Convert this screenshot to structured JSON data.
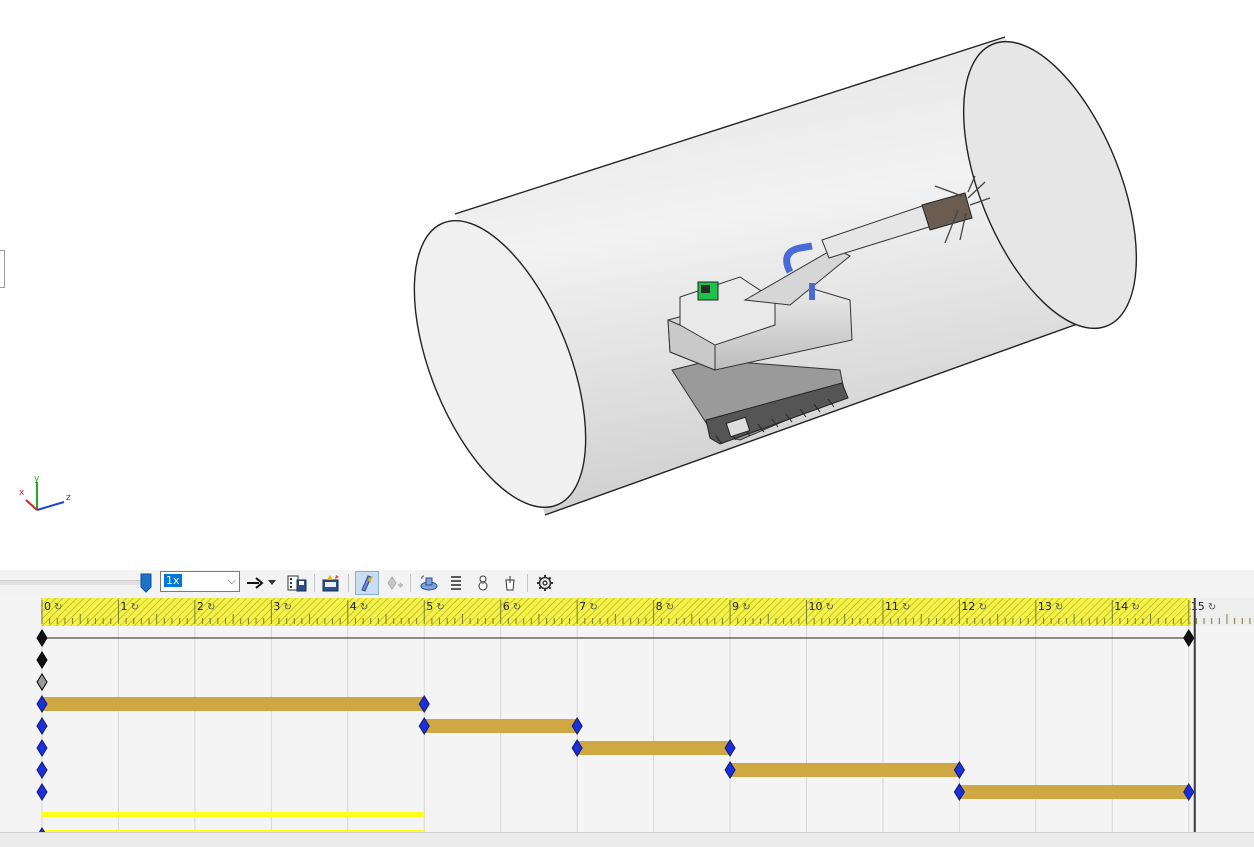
{
  "toolbar": {
    "speed": "1x",
    "buttons": [
      {
        "icon": "play-arrow-icon"
      },
      {
        "icon": "dropdown-arrow-icon"
      },
      {
        "icon": "save-animation-icon"
      },
      {
        "icon": "animation-wizard-icon"
      },
      {
        "icon": "autokey-icon",
        "active": true
      },
      {
        "icon": "add-key-icon",
        "disabled": true
      },
      {
        "icon": "motor-icon"
      },
      {
        "icon": "spring-icon"
      },
      {
        "icon": "contact-icon"
      },
      {
        "icon": "gravity-icon"
      },
      {
        "icon": "properties-gear-icon"
      }
    ]
  },
  "timeline": {
    "seconds": [
      "0",
      "1",
      "2",
      "3",
      "4",
      "5",
      "6",
      "7",
      "8",
      "9",
      "10",
      "11",
      "12",
      "13",
      "14",
      "15"
    ],
    "current_time": 15,
    "colors": {
      "bar": "#cfa843",
      "key_blue": "#1d2fd6",
      "key_black": "#111111",
      "key_grey": "#9a9a9a",
      "highlight": "#ffff1e"
    },
    "rows": [
      {
        "keys": [
          {
            "t": 0,
            "kind": "black"
          },
          {
            "t": 15,
            "kind": "black"
          }
        ],
        "line": [
          0,
          15
        ]
      },
      {
        "keys": [
          {
            "t": 0,
            "kind": "black"
          }
        ]
      },
      {
        "keys": [
          {
            "t": 0,
            "kind": "grey"
          }
        ]
      },
      {
        "keys": [
          {
            "t": 0,
            "kind": "blue"
          },
          {
            "t": 5,
            "kind": "blue"
          }
        ],
        "bar": [
          0,
          5
        ]
      },
      {
        "keys": [
          {
            "t": 0,
            "kind": "blue"
          },
          {
            "t": 5,
            "kind": "blue"
          },
          {
            "t": 7,
            "kind": "blue"
          }
        ],
        "bar": [
          5,
          7
        ]
      },
      {
        "keys": [
          {
            "t": 0,
            "kind": "blue"
          },
          {
            "t": 7,
            "kind": "blue"
          },
          {
            "t": 9,
            "kind": "blue"
          }
        ],
        "bar": [
          7,
          9
        ]
      },
      {
        "keys": [
          {
            "t": 0,
            "kind": "blue"
          },
          {
            "t": 9,
            "kind": "blue"
          },
          {
            "t": 12,
            "kind": "blue"
          }
        ],
        "bar": [
          9,
          12
        ]
      },
      {
        "keys": [
          {
            "t": 0,
            "kind": "blue"
          },
          {
            "t": 12,
            "kind": "blue"
          },
          {
            "t": 15,
            "kind": "blue"
          }
        ],
        "bar": [
          12,
          15
        ]
      },
      {
        "keys": [],
        "highlight": [
          0,
          5
        ]
      },
      {
        "keys": [
          {
            "t": 0,
            "kind": "blue"
          }
        ],
        "highlight": [
          0,
          5
        ]
      }
    ]
  },
  "triad": {
    "x": "x",
    "y": "y",
    "z": "z"
  }
}
